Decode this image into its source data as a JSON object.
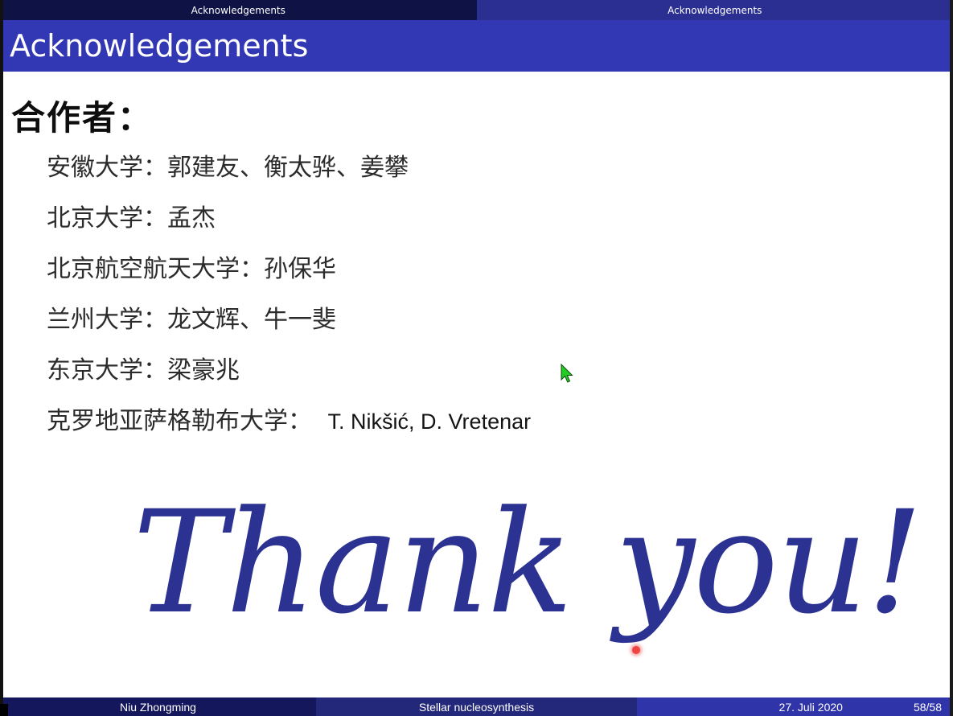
{
  "nav": {
    "left_section": "Acknowledgements",
    "right_section": "Acknowledgements"
  },
  "slide": {
    "title": "Acknowledgements",
    "heading": "合作者：",
    "collaborators": [
      {
        "text": "安徽大学：郭建友、衡太骅、姜攀"
      },
      {
        "text": "北京大学：孟杰"
      },
      {
        "text": "北京航空航天大学：孙保华"
      },
      {
        "text": "兰州大学：龙文辉、牛一斐"
      },
      {
        "text": "东京大学：梁豪兆"
      },
      {
        "text": "克罗地亚萨格勒布大学：",
        "latin": "T. Nikšić, D. Vretenar"
      }
    ],
    "thank_you": "Thank you!"
  },
  "footer": {
    "author": "Niu Zhongming",
    "talk_title": "Stellar nucleosynthesis",
    "date": "27. Juli 2020",
    "page": "58/58"
  },
  "colors": {
    "title_bar": "#3237b3",
    "nav_dark": "#0f1244",
    "nav_light": "#2a2f91",
    "thank_you": "#2c3292",
    "cursor": "#22cc22",
    "laser": "#f04444"
  },
  "icons": {
    "cursor": "green-arrow-cursor",
    "laser": "laser-pointer-dot"
  }
}
